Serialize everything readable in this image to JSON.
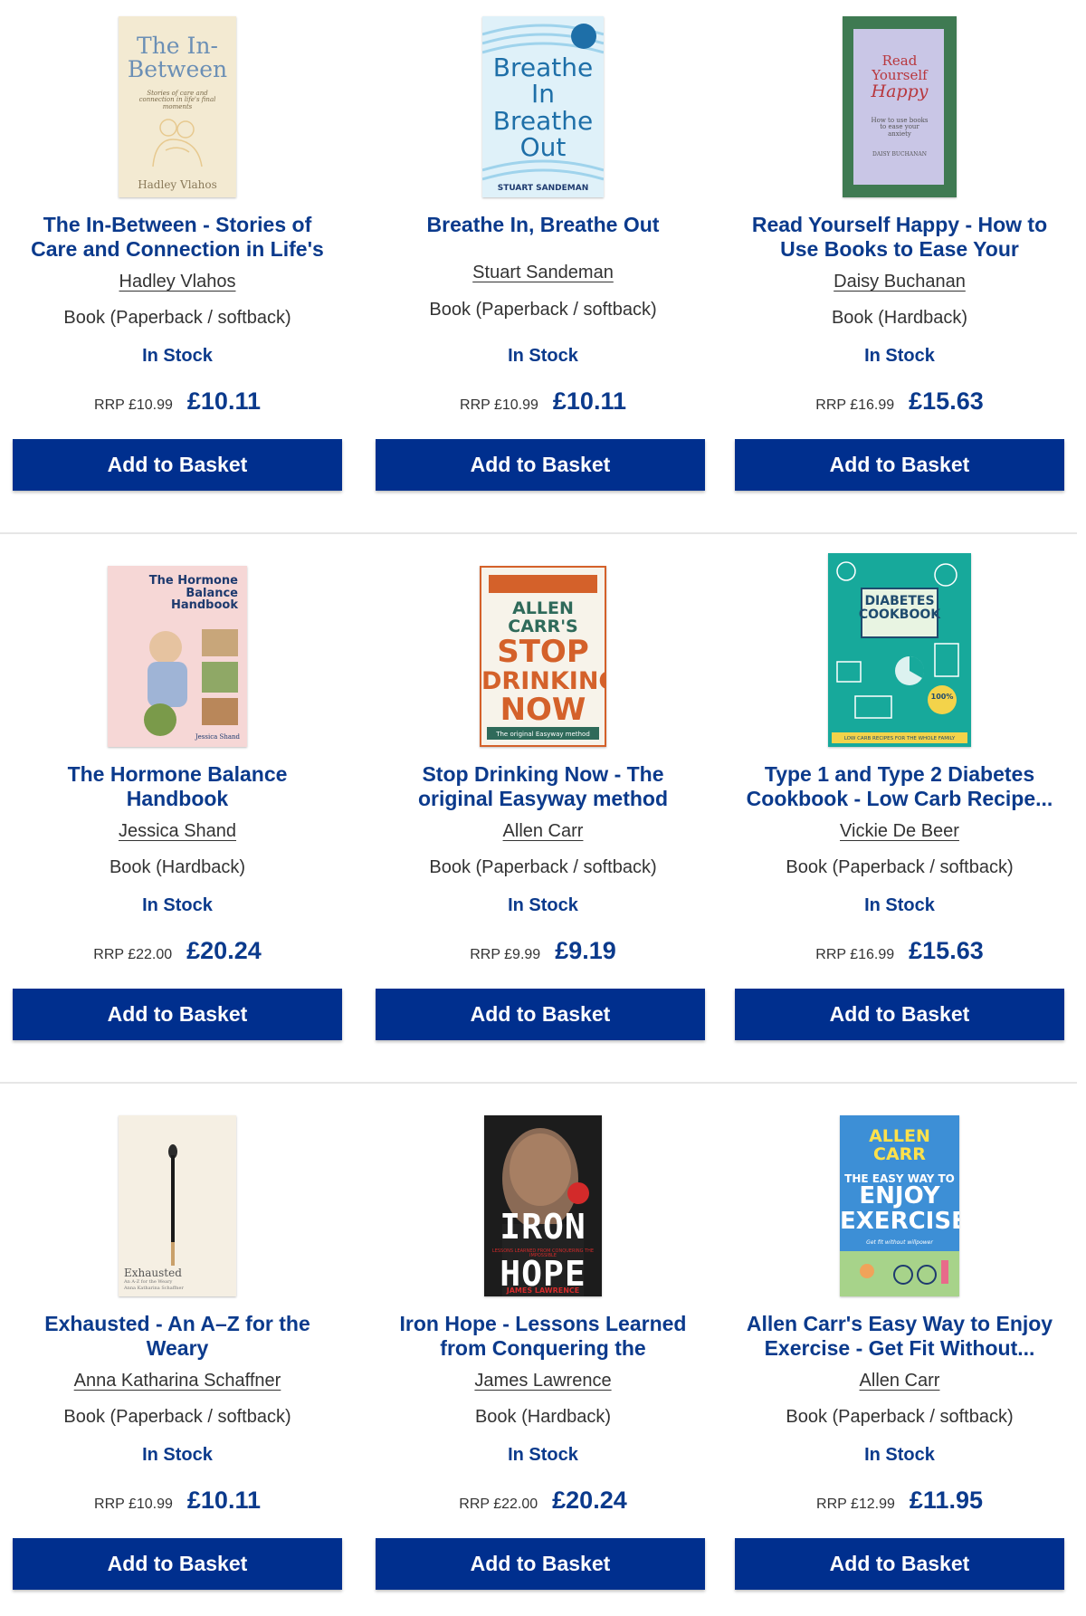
{
  "products": [
    {
      "title": "The In-Between - Stories of Care and Connection in Life's Final...",
      "author": "Hadley Vlahos",
      "format": "Book (Paperback / softback)",
      "stock": "In Stock",
      "rrp": "RRP £10.99",
      "price": "£10.11",
      "button": "Add to Basket",
      "cover": {
        "lines": [
          "The In-",
          "Between"
        ],
        "sub": "Stories of care and connection in life's final moments",
        "byline": "Hadley Vlahos",
        "bg": "#f3ead2",
        "fg": "#6b8fb5"
      }
    },
    {
      "title": "Breathe In, Breathe Out",
      "author": "Stuart Sandeman",
      "format": "Book (Paperback / softback)",
      "stock": "In Stock",
      "rrp": "RRP £10.99",
      "price": "£10.11",
      "button": "Add to Basket",
      "cover": {
        "lines": [
          "Breathe",
          "In",
          "Breathe",
          "Out"
        ],
        "sub": "",
        "byline": "STUART SANDEMAN",
        "bg": "#dff1f9",
        "fg": "#1e6fa8"
      }
    },
    {
      "title": "Read Yourself Happy - How to Use Books to Ease Your Anxiety",
      "author": "Daisy Buchanan",
      "format": "Book (Hardback)",
      "stock": "In Stock",
      "rrp": "RRP £16.99",
      "price": "£15.63",
      "button": "Add to Basket",
      "cover": {
        "lines": [
          "Read",
          "Yourself",
          "Happy"
        ],
        "sub": "How to use books to ease your anxiety",
        "byline": "DAISY BUCHANAN",
        "bg": "#3f7a52",
        "fg": "#b8373d"
      }
    },
    {
      "title": "The Hormone Balance Handbook",
      "author": "Jessica Shand",
      "format": "Book (Hardback)",
      "stock": "In Stock",
      "rrp": "RRP £22.00",
      "price": "£20.24",
      "button": "Add to Basket",
      "cover": {
        "lines": [
          "The Hormone",
          "Balance",
          "Handbook"
        ],
        "sub": "",
        "byline": "Jessica Shand",
        "bg": "#f6d7d6",
        "fg": "#1e3a6e"
      }
    },
    {
      "title": "Stop Drinking Now - The original Easyway method",
      "author": "Allen Carr",
      "format": "Book (Paperback / softback)",
      "stock": "In Stock",
      "rrp": "RRP £9.99",
      "price": "£9.19",
      "button": "Add to Basket",
      "cover": {
        "lines": [
          "ALLEN CARR'S",
          "STOP",
          "DRINKING",
          "NOW"
        ],
        "sub": "The original Easyway method",
        "byline": "",
        "bg": "#f7f3ea",
        "fg": "#d4612a"
      }
    },
    {
      "title": "Type 1 and Type 2 Diabetes Cookbook - Low Carb Recipe...",
      "author": "Vickie De Beer",
      "format": "Book (Paperback / softback)",
      "stock": "In Stock",
      "rrp": "RRP £16.99",
      "price": "£15.63",
      "button": "Add to Basket",
      "cover": {
        "lines": [
          "DIABETES",
          "COOKBOOK"
        ],
        "sub": "LOW CARB RECIPES FOR THE WHOLE FAMILY",
        "byline": "100%",
        "bg": "#17a99b",
        "fg": "#1f4b6e"
      }
    },
    {
      "title": "Exhausted - An A–Z for the Weary",
      "author": "Anna Katharina Schaffner",
      "format": "Book (Paperback / softback)",
      "stock": "In Stock",
      "rrp": "RRP £10.99",
      "price": "£10.11",
      "button": "Add to Basket",
      "cover": {
        "lines": [
          "Exhausted"
        ],
        "sub": "An A-Z for the Weary",
        "byline": "Anna Katharina Schaffner",
        "bg": "#f5efe3",
        "fg": "#555555"
      }
    },
    {
      "title": "Iron Hope - Lessons Learned from Conquering the Impossible",
      "author": "James Lawrence",
      "format": "Book (Hardback)",
      "stock": "In Stock",
      "rrp": "RRP £22.00",
      "price": "£20.24",
      "button": "Add to Basket",
      "cover": {
        "lines": [
          "IRON",
          "HOPE"
        ],
        "sub": "LESSONS LEARNED FROM CONQUERING THE IMPOSSIBLE",
        "byline": "JAMES LAWRENCE",
        "bg": "#2a2a2a",
        "fg": "#ffffff"
      }
    },
    {
      "title": "Allen Carr's Easy Way to Enjoy Exercise - Get Fit Without...",
      "author": "Allen Carr",
      "format": "Book (Paperback / softback)",
      "stock": "In Stock",
      "rrp": "RRP £12.99",
      "price": "£11.95",
      "button": "Add to Basket",
      "cover": {
        "lines": [
          "ALLEN CARR",
          "THE EASY WAY TO",
          "ENJOY",
          "EXERCISE"
        ],
        "sub": "Get fit without willpower",
        "byline": "",
        "bg": "#2f7fc3",
        "fg": "#ffe14a"
      }
    }
  ],
  "colors": {
    "brand": "#002f8e",
    "title_blue": "#0b3a8c",
    "divider": "#e6e6e6"
  }
}
